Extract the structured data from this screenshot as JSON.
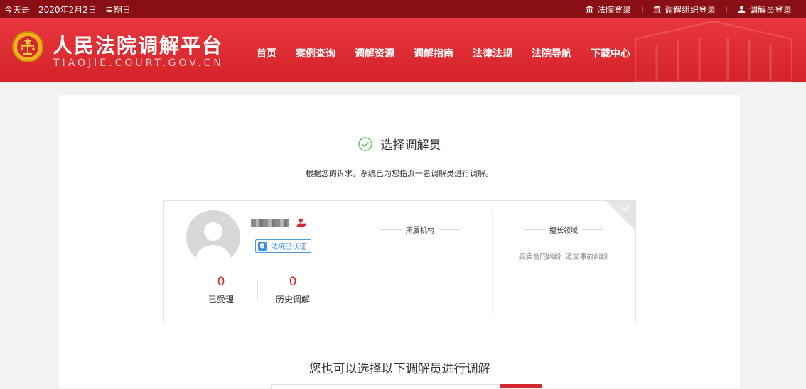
{
  "topbar": {
    "date_prefix": "今天是",
    "date": "2020年2月2日",
    "weekday": "星期日",
    "links": [
      {
        "label": "法院登录",
        "icon": "court-building-icon"
      },
      {
        "label": "调解组织登录",
        "icon": "court-building-icon"
      },
      {
        "label": "调解员登录",
        "icon": "person-icon"
      }
    ]
  },
  "header": {
    "title": "人民法院调解平台",
    "subtitle": "TIAOJIE.COURT.GOV.CN",
    "nav": [
      "首页",
      "案例查询",
      "调解资源",
      "调解指南",
      "法律法规",
      "法院导航",
      "下载中心"
    ]
  },
  "main": {
    "step_title": "选择调解员",
    "description": "根据您的诉求，系统已为您指派一名调解员进行调解。",
    "mediator": {
      "badge": "法院已认证",
      "accepted_count": "0",
      "accepted_label": "已受理",
      "history_count": "0",
      "history_label": "历史调解",
      "org_header": "所属机构",
      "skills_header": "擅长领域",
      "skills": [
        "买卖合同纠纷",
        "道交事故纠纷"
      ]
    },
    "alt_title": "您也可以选择以下调解员进行调解"
  },
  "colors": {
    "topbar_bg": "#8a0f14",
    "header_red": "#d4232a",
    "accent_red": "#d7262c",
    "check_green": "#5fc25f",
    "badge_blue": "#3a8ee0"
  }
}
